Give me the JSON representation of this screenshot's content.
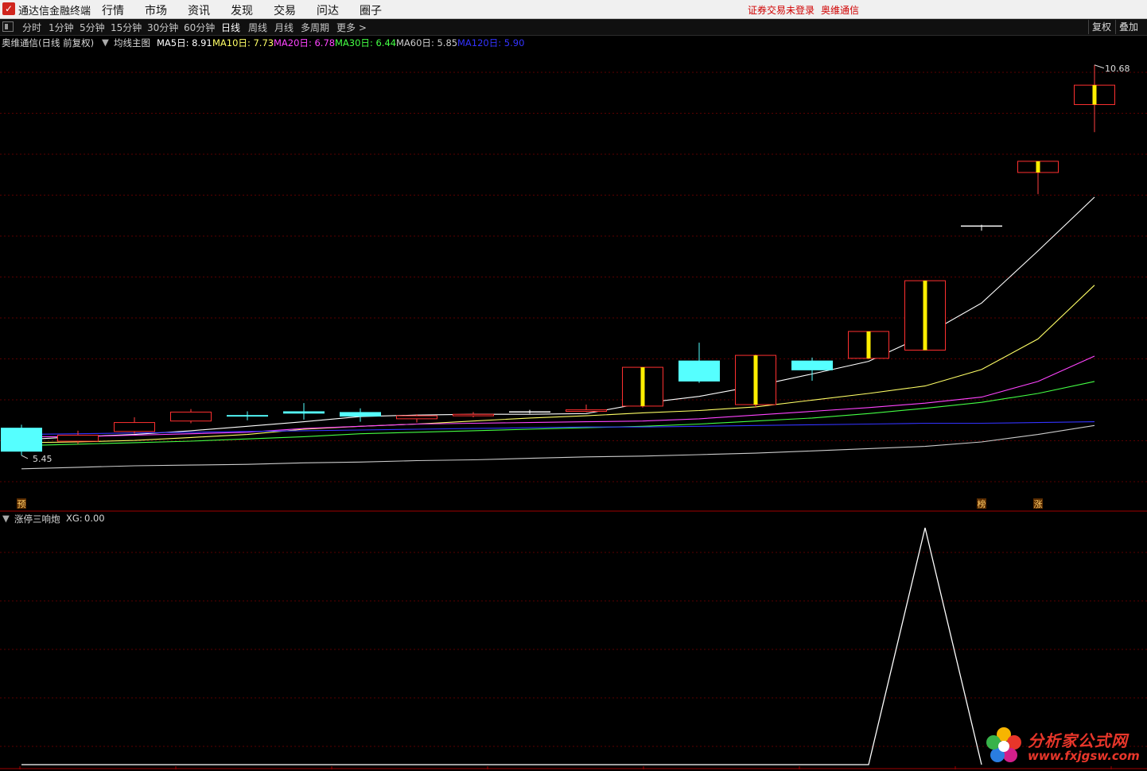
{
  "app": {
    "title": "通达信金融终端",
    "menu": [
      "行情",
      "市场",
      "资讯",
      "发现",
      "交易",
      "问达",
      "圈子"
    ],
    "login_notice": "证券交易未登录",
    "stock_name": "奥维通信"
  },
  "toolbar": {
    "tabs": [
      "分时",
      "1分钟",
      "5分钟",
      "15分钟",
      "30分钟",
      "60分钟",
      "日线",
      "周线",
      "月线",
      "多周期",
      "更多 >"
    ],
    "active_tab": "日线",
    "right_buttons": [
      "复权",
      "叠加"
    ]
  },
  "main_legend": {
    "title": "奥维通信(日线 前复权)",
    "indicator": "均线主图",
    "ma": [
      {
        "label": "MA5日",
        "value": "8.91",
        "color": "#ffffff"
      },
      {
        "label": "MA10日",
        "value": "7.73",
        "color": "#ffff66"
      },
      {
        "label": "MA20日",
        "value": "6.78",
        "color": "#ff44ff"
      },
      {
        "label": "MA30日",
        "value": "6.44",
        "color": "#44ff44"
      },
      {
        "label": "MA60日",
        "value": "5.85",
        "color": "#cccccc"
      },
      {
        "label": "MA120日",
        "value": "5.90",
        "color": "#3333ff"
      }
    ]
  },
  "chart_data": [
    {
      "type": "candlestick",
      "title": "奥维通信(日线 前复权)",
      "high_label": "10.68",
      "low_label": "5.45",
      "candles": [
        {
          "open": 5.82,
          "close": 5.5,
          "high": 5.86,
          "low": 5.45,
          "color": "cyan"
        },
        {
          "open": 5.64,
          "close": 5.72,
          "high": 5.78,
          "low": 5.6,
          "color": "red"
        },
        {
          "open": 5.77,
          "close": 5.89,
          "high": 5.96,
          "low": 5.74,
          "color": "red"
        },
        {
          "open": 5.91,
          "close": 6.03,
          "high": 6.07,
          "low": 5.88,
          "color": "red"
        },
        {
          "open": 5.99,
          "close": 5.97,
          "high": 6.04,
          "low": 5.92,
          "color": "cyan"
        },
        {
          "open": 6.04,
          "close": 6.01,
          "high": 6.15,
          "low": 5.93,
          "color": "cyan"
        },
        {
          "open": 6.03,
          "close": 5.97,
          "high": 6.08,
          "low": 5.9,
          "color": "cyan"
        },
        {
          "open": 5.94,
          "close": 5.98,
          "high": 6.0,
          "low": 5.89,
          "color": "red"
        },
        {
          "open": 5.98,
          "close": 6.0,
          "high": 6.03,
          "low": 5.96,
          "color": "red"
        },
        {
          "open": 6.04,
          "close": 6.04,
          "high": 6.06,
          "low": 6.01,
          "color": "white"
        },
        {
          "open": 6.04,
          "close": 6.06,
          "high": 6.13,
          "low": 6.03,
          "color": "red"
        },
        {
          "open": 6.11,
          "close": 6.63,
          "high": 6.63,
          "low": 6.09,
          "color": "red_limitup"
        },
        {
          "open": 6.72,
          "close": 6.44,
          "high": 6.96,
          "low": 6.42,
          "color": "cyan"
        },
        {
          "open": 6.13,
          "close": 6.79,
          "high": 6.8,
          "low": 6.09,
          "color": "red_limitup"
        },
        {
          "open": 6.72,
          "close": 6.59,
          "high": 6.76,
          "low": 6.45,
          "color": "cyan"
        },
        {
          "open": 6.75,
          "close": 7.11,
          "high": 7.11,
          "low": 6.74,
          "color": "red_limitup"
        },
        {
          "open": 6.86,
          "close": 7.79,
          "high": 7.79,
          "low": 6.86,
          "color": "red_limitup"
        },
        {
          "open": 8.53,
          "close": 8.53,
          "high": 8.54,
          "low": 8.46,
          "color": "white"
        },
        {
          "open": 9.24,
          "close": 9.39,
          "high": 9.39,
          "low": 8.95,
          "color": "red_limitup"
        },
        {
          "open": 10.15,
          "close": 10.41,
          "high": 10.68,
          "low": 9.78,
          "color": "red_limitup"
        }
      ],
      "ma_lines": [
        {
          "name": "MA5",
          "color": "#ffffff",
          "values": [
            5.66,
            5.7,
            5.73,
            5.78,
            5.84,
            5.9,
            5.97,
            5.99,
            6.0,
            6.0,
            6.01,
            6.15,
            6.24,
            6.38,
            6.54,
            6.71,
            7.06,
            7.49,
            8.19,
            8.91
          ]
        },
        {
          "name": "MA10",
          "color": "#ffff66",
          "values": [
            5.62,
            5.63,
            5.65,
            5.69,
            5.73,
            5.8,
            5.84,
            5.87,
            5.91,
            5.95,
            5.98,
            6.02,
            6.05,
            6.1,
            6.19,
            6.28,
            6.38,
            6.6,
            7.01,
            7.73
          ]
        },
        {
          "name": "MA20",
          "color": "#ff44ff",
          "values": [
            5.7,
            5.7,
            5.72,
            5.74,
            5.76,
            5.81,
            5.84,
            5.87,
            5.88,
            5.89,
            5.9,
            5.91,
            5.94,
            5.99,
            6.04,
            6.09,
            6.15,
            6.23,
            6.44,
            6.78
          ]
        },
        {
          "name": "MA30",
          "color": "#44ff44",
          "values": [
            5.58,
            5.6,
            5.62,
            5.64,
            5.67,
            5.7,
            5.74,
            5.76,
            5.78,
            5.8,
            5.82,
            5.84,
            5.87,
            5.91,
            5.95,
            6.01,
            6.08,
            6.16,
            6.28,
            6.44
          ]
        },
        {
          "name": "MA60",
          "color": "#cccccc",
          "values": [
            5.27,
            5.29,
            5.31,
            5.32,
            5.33,
            5.35,
            5.36,
            5.38,
            5.39,
            5.41,
            5.43,
            5.44,
            5.46,
            5.48,
            5.51,
            5.54,
            5.57,
            5.63,
            5.73,
            5.85
          ]
        },
        {
          "name": "MA120",
          "color": "#3333ff",
          "values": [
            5.73,
            5.74,
            5.75,
            5.76,
            5.77,
            5.78,
            5.79,
            5.8,
            5.81,
            5.82,
            5.83,
            5.83,
            5.84,
            5.85,
            5.86,
            5.87,
            5.88,
            5.88,
            5.89,
            5.9
          ]
        }
      ],
      "markers": [
        {
          "index": 0,
          "text": "预"
        },
        {
          "index": 17,
          "text": "榜"
        },
        {
          "index": 18,
          "text": "涨"
        }
      ],
      "ylim": [
        5.14,
        10.88
      ]
    },
    {
      "type": "line",
      "title": "涨停三响炮",
      "series": [
        {
          "name": "XG",
          "values": [
            0,
            0,
            0,
            0,
            0,
            0,
            0,
            0,
            0,
            0,
            0,
            0,
            0,
            0,
            0,
            0,
            1,
            0
          ]
        }
      ],
      "ylim": [
        0,
        1
      ]
    }
  ],
  "indicator_legend": {
    "name": "涨停三响炮",
    "xg_label": "XG:",
    "xg_value": "0.00"
  },
  "watermark": {
    "cn": "分析家公式网",
    "url": "www.fxjgsw.com"
  }
}
